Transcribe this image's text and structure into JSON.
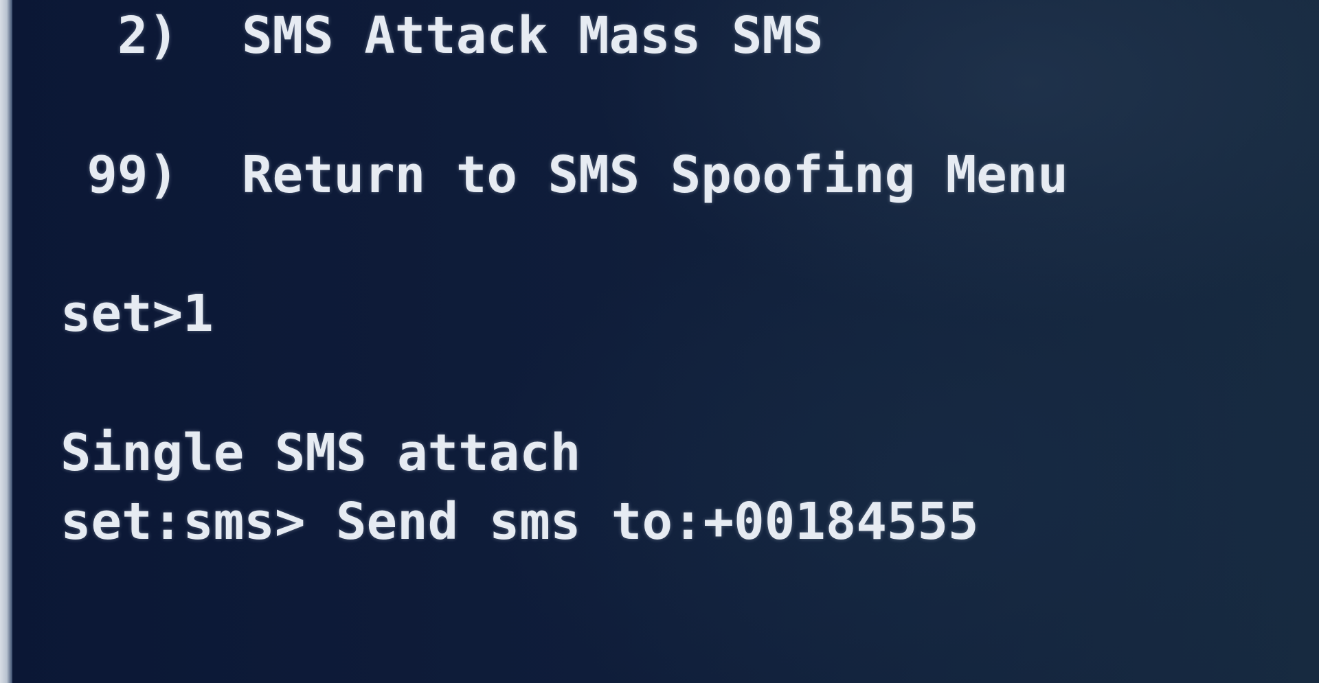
{
  "terminal": {
    "menu_items": [
      {
        "number": "2)",
        "label": "SMS Attack Mass SMS"
      },
      {
        "number": "99)",
        "label": "Return to SMS Spoofing Menu"
      }
    ],
    "prompt_line": "set>1",
    "status_line": "Single SMS attach",
    "input_prompt": "set:sms> Send sms to:+00184555"
  },
  "colors": {
    "background": "#0d1830",
    "text": "#e6ebf2"
  }
}
